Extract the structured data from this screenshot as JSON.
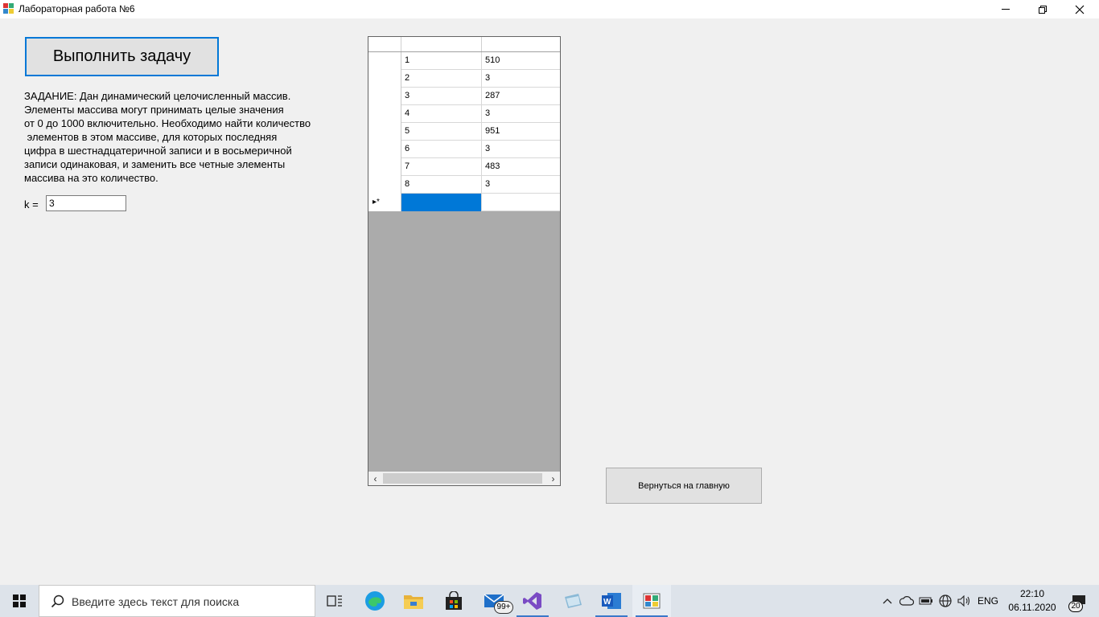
{
  "window": {
    "title": "Лабораторная работа №6"
  },
  "main": {
    "run_button_label": "Выполнить задачу",
    "task_lines": [
      "ЗАДАНИЕ: Дан динамический целочисленный массив.",
      "Элементы массива могут принимать целые значения",
      "от 0 до 1000 включительно. Необходимо найти количество",
      " элементов в этом массиве, для которых последняя",
      "цифра в шестнадцатеричной записи и в восьмеричной",
      "записи одинаковая, и заменить все четные элементы",
      "массива на это количество."
    ],
    "k_label": "k =",
    "k_value": "3",
    "back_button_label": "Вернуться на главную"
  },
  "grid": {
    "rows": [
      {
        "index": "1",
        "value": "510"
      },
      {
        "index": "2",
        "value": "3"
      },
      {
        "index": "3",
        "value": "287"
      },
      {
        "index": "4",
        "value": "3"
      },
      {
        "index": "5",
        "value": "951"
      },
      {
        "index": "6",
        "value": "3"
      },
      {
        "index": "7",
        "value": "483"
      },
      {
        "index": "8",
        "value": "3"
      }
    ],
    "new_row_marker": "▸*"
  },
  "taskbar": {
    "search_placeholder": "Введите здесь текст для поиска",
    "mail_badge": "99+",
    "language": "ENG",
    "time": "22:10",
    "date": "06.11.2020",
    "notification_count": "20"
  },
  "colors": {
    "accent": "#0078d7",
    "grid_background": "#ababab",
    "window_background": "#f0f0f0"
  }
}
